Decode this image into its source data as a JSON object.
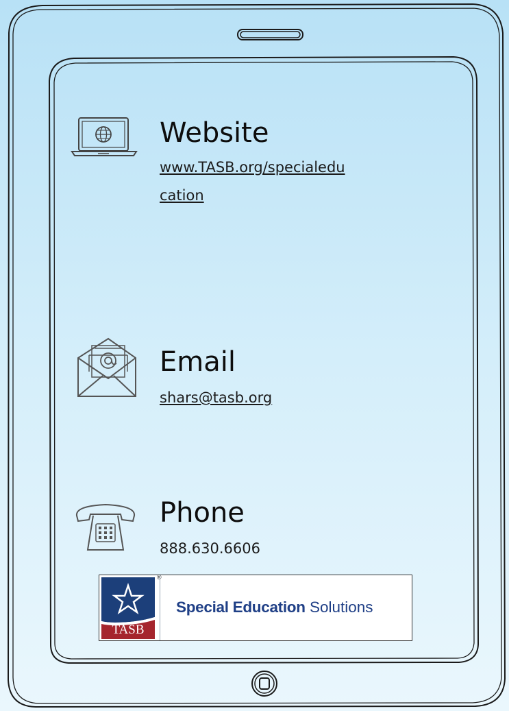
{
  "colors": {
    "background_top": "#b8e1f6",
    "background_bottom": "#eaf7fd",
    "outline": "#1a1a1a",
    "tasb_blue": "#1c3f7a",
    "tasb_red": "#a5252d",
    "brand_text": "#1f3f86"
  },
  "icons": {
    "website": "laptop-globe-icon",
    "email": "open-envelope-at-icon",
    "phone": "desk-telephone-icon",
    "speaker": "speaker-slot-icon",
    "home": "home-button-icon"
  },
  "contacts": {
    "website": {
      "heading": "Website",
      "line1": "www.TASB.org/specialedu",
      "line2": "cation"
    },
    "email": {
      "heading": "Email",
      "value": "shars@tasb.org"
    },
    "phone": {
      "heading": "Phone",
      "value": "888.630.6606"
    }
  },
  "logo": {
    "registered_mark": "®",
    "org": "TASB",
    "brand_bold": "Special Education",
    "brand_light": "Solutions"
  }
}
